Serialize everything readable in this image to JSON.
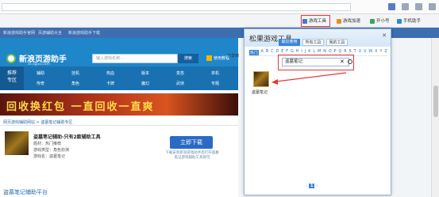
{
  "browser": {
    "toolbar": {
      "game_tools": "游戏工具",
      "game_accel": "游戏加速",
      "open_small": "开小号",
      "mobile": "手机助手"
    },
    "bookmarks": [
      "新浪游戏助手官网",
      "页游辅助大全",
      "新浪游戏助手下载"
    ]
  },
  "site": {
    "logo_text": "新浪页游助手",
    "logo_sub": "zs.sguo.com",
    "search_placeholder": "输入游戏名称...",
    "search_button": "搜索",
    "head_link": "使用教程",
    "share": "分享到",
    "nav_left": [
      "推荐",
      "专区"
    ],
    "nav_items": [
      "辅助",
      "挂机",
      "热血",
      "版本",
      "变态",
      "单机",
      "传奇",
      "角色",
      "卡牌",
      "魔幻",
      "武侠",
      "专题"
    ],
    "banner": "回收换红包 一直回收一直爽",
    "breadcrumb": "网页游戏辅助网站 > 盗墓笔记辅助专区",
    "game": {
      "title": "盗墓笔记辅助-只有2款辅助工具",
      "meta1": "题材：热门推荐",
      "meta2": "游戏类型：角色扮演",
      "meta3": "游戏名：盗墓笔记"
    },
    "download_button": "立即下载",
    "download_note": "下载安装新浪游戏助手后打开盗墓笔记游戏辅助工具即可",
    "section_title": "盗墓笔记辅助平台"
  },
  "popup": {
    "title": "松果游戏工具",
    "tabs": [
      "最近使用",
      "所有工具",
      "我的工具"
    ],
    "alphabet": [
      "热门",
      "A",
      "B",
      "C",
      "D",
      "E",
      "F",
      "G",
      "H",
      "I",
      "J",
      "K",
      "L",
      "M",
      "N",
      "O",
      "P",
      "Q",
      "R",
      "S",
      "T",
      "U",
      "V",
      "W",
      "X",
      "Y",
      "Z"
    ],
    "search_value": "盗墓笔记",
    "result_name": "盗墓笔记",
    "page": "1"
  }
}
